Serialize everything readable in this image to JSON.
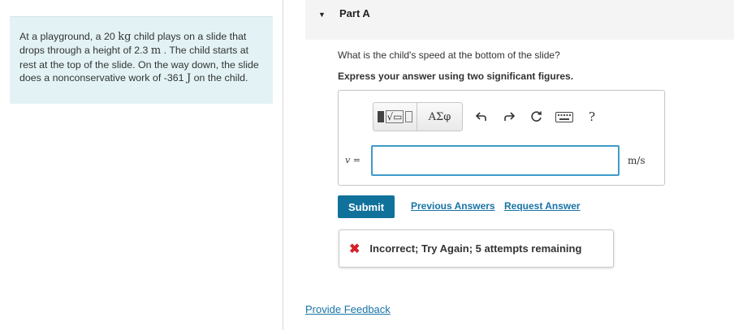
{
  "problem": {
    "text_1": "At a playground, a 20 ",
    "unit_kg": "kg",
    "text_2": " child plays on a slide that drops through a height of 2.3 ",
    "unit_m": "m",
    "text_3": " . The child starts at rest at the top of the slide. On the way down, the slide does a nonconservative work of -361 ",
    "unit_J": "J",
    "text_4": " on the child."
  },
  "part": {
    "arrow": "▼",
    "title": "Part A"
  },
  "question": "What is the child's speed at the bottom of the slide?",
  "instruction": "Express your answer using two significant figures.",
  "toolbar": {
    "templates_icon": "templates-icon",
    "greek_label": "ΑΣφ",
    "undo_icon": "undo-icon",
    "redo_icon": "redo-icon",
    "reset_icon": "reset-icon",
    "keyboard_icon": "keyboard-icon",
    "help_label": "?"
  },
  "answer": {
    "variable": "v =",
    "value": "",
    "unit": "m/s"
  },
  "actions": {
    "submit_label": "Submit",
    "previous_answers": "Previous Answers",
    "request_answer": "Request Answer"
  },
  "feedback": {
    "icon": "x-icon",
    "text": "Incorrect; Try Again; 5 attempts remaining",
    "color": "#d42027"
  },
  "footer": {
    "provide_feedback": "Provide Feedback"
  },
  "colors": {
    "problem_bg": "#e3f3f5",
    "accent": "#10719b",
    "link": "#1873a6",
    "input_border": "#3e9bc9"
  }
}
